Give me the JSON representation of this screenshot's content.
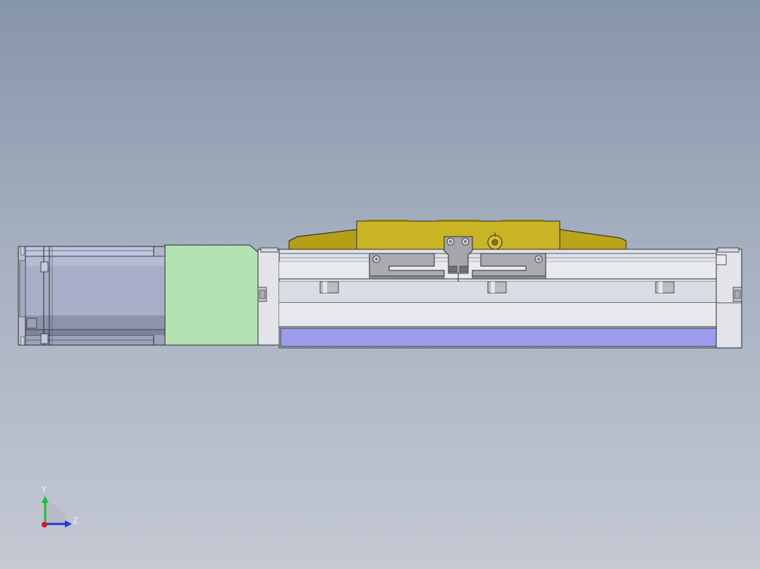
{
  "viewport": {
    "background_top": "#8795aa",
    "background_bottom": "#c4c9d3"
  },
  "model": {
    "motor_color": "#a9aec8",
    "adapter_color": "#b2e2b2",
    "carriage_plate_color": "#c9b524",
    "rail_color": "#dfe2e8",
    "cover_strip_color": "#9c9cee",
    "end_block_color": "#e2e4ea"
  },
  "triad": {
    "y_label": "Y",
    "z_label": "Z",
    "y_axis_color": "#1fbf2a",
    "z_axis_color": "#1f3ad8",
    "x_axis_color": "#d01c1c"
  }
}
